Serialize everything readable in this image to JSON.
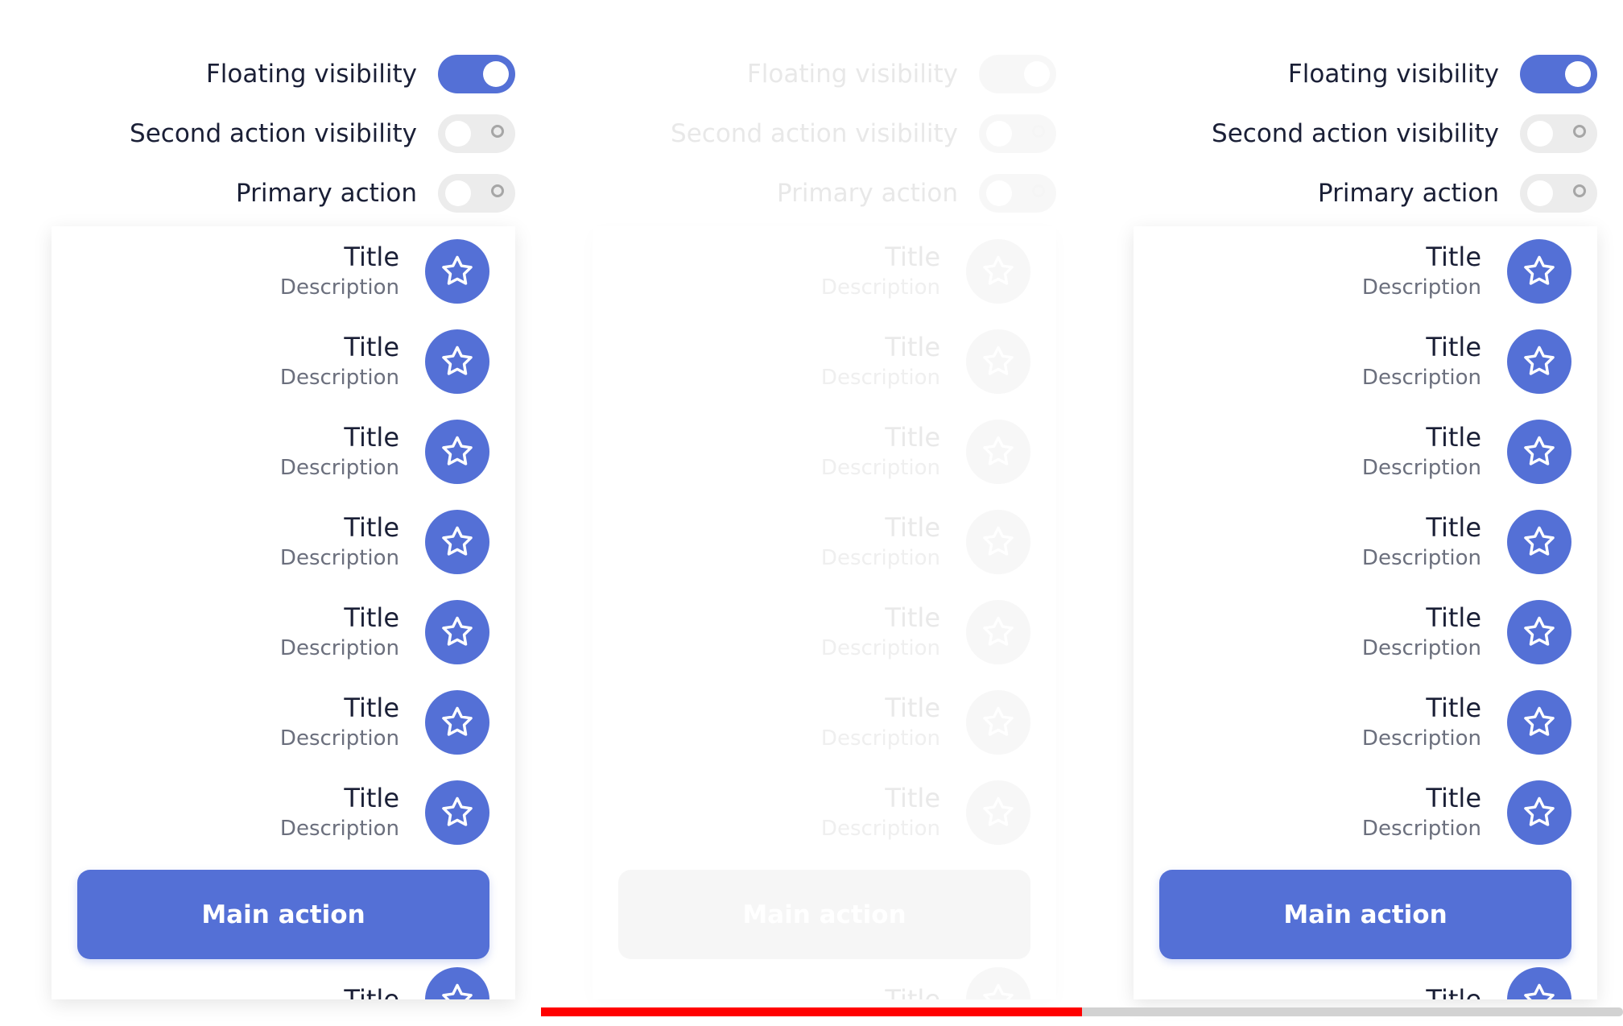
{
  "colors": {
    "accent": "#5470d6",
    "text": "#1a1f36",
    "muted": "#6b6f7d",
    "scroll_thumb": "#ff0000",
    "scroll_track": "#d2d2d2"
  },
  "icons": {
    "fab": "star-icon"
  },
  "scroll": {
    "thumb_fraction": 0.5,
    "position": "middle"
  },
  "columns": [
    {
      "state": "enabled",
      "toggles": [
        {
          "label": "Floating visibility",
          "on": true
        },
        {
          "label": "Second action visibility",
          "on": false
        },
        {
          "label": "Primary action",
          "on": false
        }
      ],
      "items": [
        {
          "title": "Title",
          "description": "Description"
        },
        {
          "title": "Title",
          "description": "Description"
        },
        {
          "title": "Title",
          "description": "Description"
        },
        {
          "title": "Title",
          "description": "Description"
        },
        {
          "title": "Title",
          "description": "Description"
        },
        {
          "title": "Title",
          "description": "Description"
        },
        {
          "title": "Title",
          "description": "Description"
        },
        {
          "title": "Title",
          "description": ""
        }
      ],
      "main_action": "Main action"
    },
    {
      "state": "disabled",
      "toggles": [
        {
          "label": "Floating visibility",
          "on": true
        },
        {
          "label": "Second action visibility",
          "on": false
        },
        {
          "label": "Primary action",
          "on": false
        }
      ],
      "items": [
        {
          "title": "Title",
          "description": "Description"
        },
        {
          "title": "Title",
          "description": "Description"
        },
        {
          "title": "Title",
          "description": "Description"
        },
        {
          "title": "Title",
          "description": "Description"
        },
        {
          "title": "Title",
          "description": "Description"
        },
        {
          "title": "Title",
          "description": "Description"
        },
        {
          "title": "Title",
          "description": "Description"
        },
        {
          "title": "Title",
          "description": ""
        }
      ],
      "main_action": "Main action"
    },
    {
      "state": "enabled",
      "toggles": [
        {
          "label": "Floating visibility",
          "on": true
        },
        {
          "label": "Second action visibility",
          "on": false
        },
        {
          "label": "Primary action",
          "on": false
        }
      ],
      "items": [
        {
          "title": "Title",
          "description": "Description"
        },
        {
          "title": "Title",
          "description": "Description"
        },
        {
          "title": "Title",
          "description": "Description"
        },
        {
          "title": "Title",
          "description": "Description"
        },
        {
          "title": "Title",
          "description": "Description"
        },
        {
          "title": "Title",
          "description": "Description"
        },
        {
          "title": "Title",
          "description": "Description"
        },
        {
          "title": "Title",
          "description": ""
        }
      ],
      "main_action": "Main action"
    }
  ]
}
